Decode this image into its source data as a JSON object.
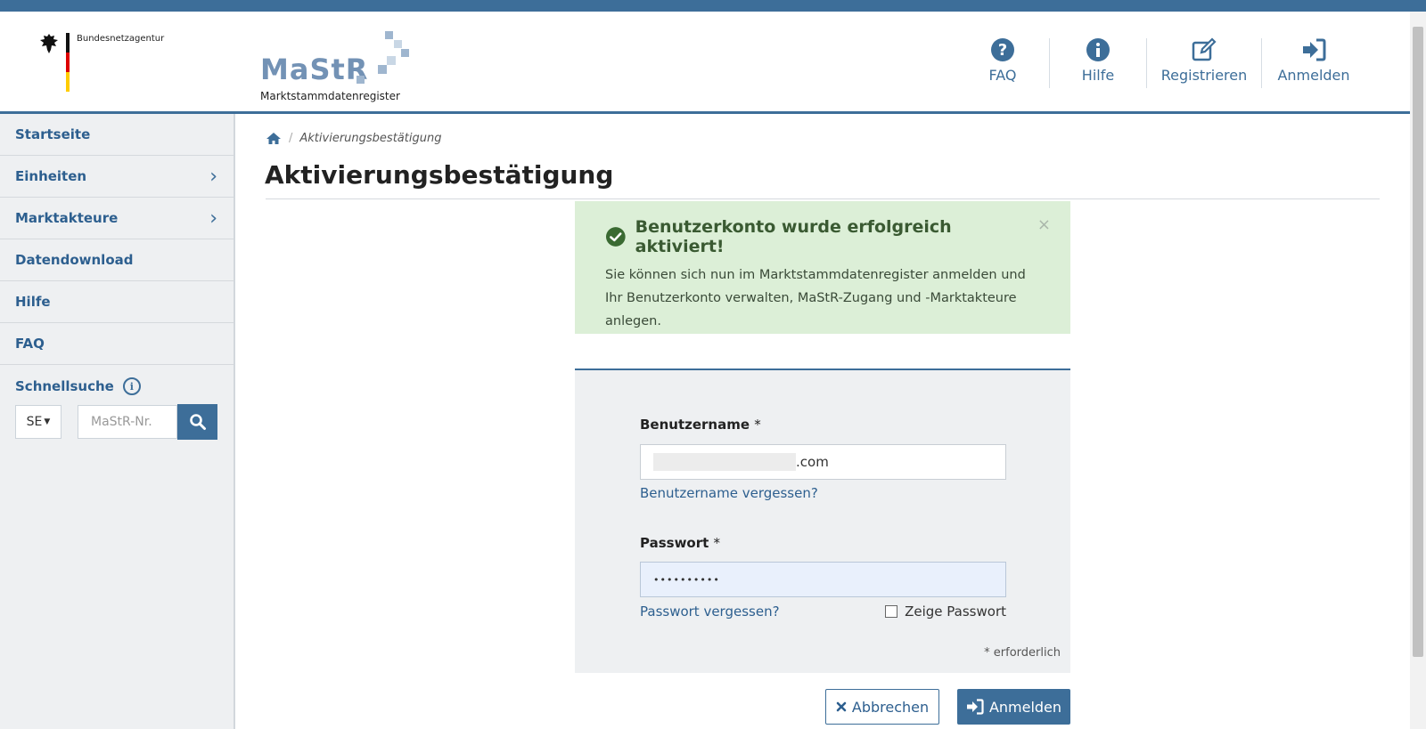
{
  "header": {
    "org_name": "Bundesnetzagentur",
    "logo_word": "MaStR",
    "logo_subtitle": "Marktstammdatenregister",
    "nav": [
      {
        "label": "FAQ",
        "icon": "question-circle-icon"
      },
      {
        "label": "Hilfe",
        "icon": "info-circle-icon"
      },
      {
        "label": "Registrieren",
        "icon": "edit-icon"
      },
      {
        "label": "Anmelden",
        "icon": "sign-in-icon"
      }
    ]
  },
  "sidebar": {
    "items": [
      {
        "label": "Startseite",
        "has_submenu": false
      },
      {
        "label": "Einheiten",
        "has_submenu": true
      },
      {
        "label": "Marktakteure",
        "has_submenu": true
      },
      {
        "label": "Datendownload",
        "has_submenu": false
      },
      {
        "label": "Hilfe",
        "has_submenu": false
      },
      {
        "label": "FAQ",
        "has_submenu": false
      }
    ],
    "quick_search": {
      "title": "Schnellsuche",
      "select_value": "SE",
      "placeholder": "MaStR-Nr."
    }
  },
  "breadcrumb": {
    "current": "Aktivierungsbestätigung"
  },
  "page_title": "Aktivierungsbestätigung",
  "alert": {
    "title": "Benutzerkonto wurde erfolgreich aktiviert!",
    "close": "×",
    "message": "Sie können sich nun im Marktstammdatenregister anmelden und Ihr Benutzerkonto verwalten, MaStR-Zugang und -Marktakteure anlegen."
  },
  "login_form": {
    "username_label": "Benutzername",
    "username_value": ".com",
    "forgot_username": "Benutzername vergessen?",
    "password_label": "Passwort",
    "password_value": "••••••••••",
    "forgot_password": "Passwort vergessen?",
    "show_password": "Zeige Passwort",
    "required_marker": "*",
    "required_note": "* erforderlich",
    "cancel_label": "Abbrechen",
    "login_label": "Anmelden"
  },
  "colors": {
    "primary": "#3d6e99",
    "success_bg": "#dcefd7",
    "sidebar_bg": "#eef0f2"
  }
}
